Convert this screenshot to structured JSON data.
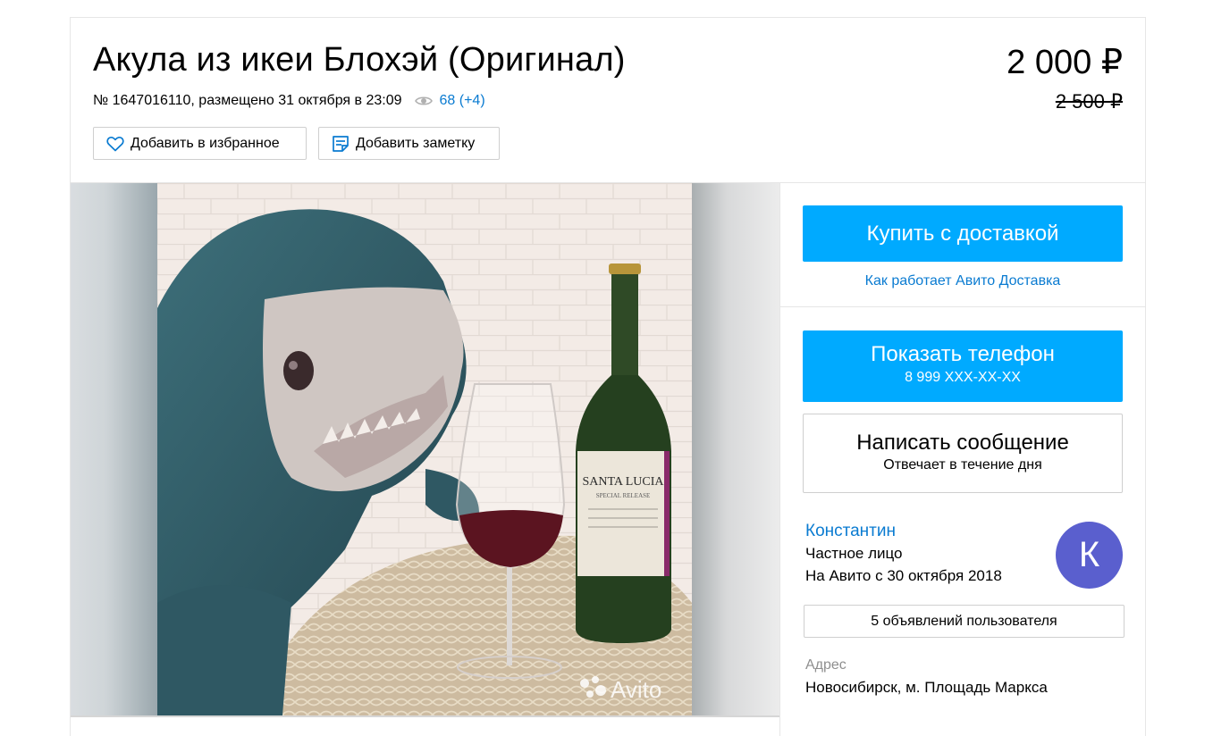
{
  "listing": {
    "title": "Акула из икеи Блохэй (Оригинал)",
    "meta": "№ 1647016110, размещено 31 октября в 23:09",
    "views": "68 (+4)",
    "price": "2 000 ₽",
    "old_price": "2 500 ₽"
  },
  "actions": {
    "favorite": "Добавить в избранное",
    "note": "Добавить заметку"
  },
  "photo": {
    "bottle_label_top": "SANTA LUCIA",
    "bottle_label_sub": "SPECIAL RELEASE",
    "watermark": "Avito"
  },
  "sidebar": {
    "buy": "Купить с доставкой",
    "delivery_link": "Как работает Авито Доставка",
    "phone_title": "Показать телефон",
    "phone_number": "8 999 XXX-XX-XX",
    "message_title": "Написать сообщение",
    "message_sub": "Отвечает в течение дня"
  },
  "seller": {
    "name": "Константин",
    "type": "Частное лицо",
    "since": "На Авито с 30 октября 2018",
    "avatar_letter": "К",
    "ads_button": "5 объявлений пользователя"
  },
  "address": {
    "label": "Адрес",
    "value": "Новосибирск, м. Площадь Маркса"
  },
  "colors": {
    "accent_blue": "#00aaff",
    "link_blue": "#0a7bd1",
    "avatar": "#5a5fce"
  }
}
